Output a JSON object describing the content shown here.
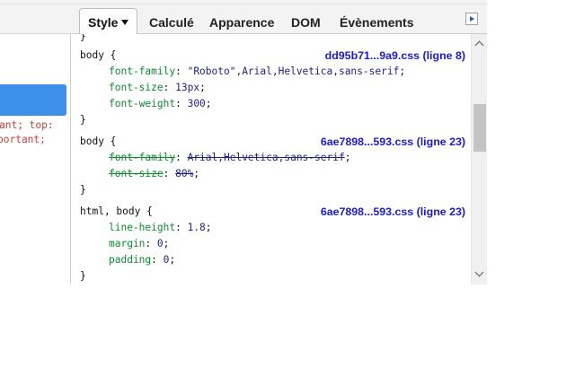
{
  "left_panel": {
    "code_lines": [
      "ant; top:",
      "portant;"
    ]
  },
  "tabs": [
    {
      "label": "Style",
      "active": true
    },
    {
      "label": "Calculé",
      "active": false
    },
    {
      "label": "Apparence",
      "active": false
    },
    {
      "label": "DOM",
      "active": false
    },
    {
      "label": "Évènements",
      "active": false
    }
  ],
  "style_pane": {
    "top_brace": "}",
    "rules": [
      {
        "selector": "body {",
        "source": "dd95b71...9a9.css (ligne 8)",
        "declarations": [
          {
            "property": "font-family",
            "value": "\"Roboto\",Arial,Helvetica,sans-serif",
            "overridden": false
          },
          {
            "property": "font-size",
            "value": "13px",
            "overridden": false
          },
          {
            "property": "font-weight",
            "value": "300",
            "overridden": false
          }
        ],
        "close": "}"
      },
      {
        "selector": "body {",
        "source": "6ae7898...593.css (ligne 23)",
        "declarations": [
          {
            "property": "font-family",
            "value": "Arial,Helvetica,sans-serif",
            "overridden": true
          },
          {
            "property": "font-size",
            "value": "80%",
            "overridden": true
          }
        ],
        "close": "}"
      },
      {
        "selector": "html, body {",
        "source": "6ae7898...593.css (ligne 23)",
        "declarations": [
          {
            "property": "line-height",
            "value": "1.8",
            "overridden": false
          },
          {
            "property": "margin",
            "value": "0",
            "overridden": false
          },
          {
            "property": "padding",
            "value": "0",
            "overridden": false
          }
        ],
        "close": "}"
      }
    ]
  },
  "colors": {
    "property": "#0f8a2e",
    "value": "#1f1f8a",
    "source_link": "#1a1ad8",
    "selection": "#3d8fe8",
    "left_code": "#cc3b3b"
  }
}
